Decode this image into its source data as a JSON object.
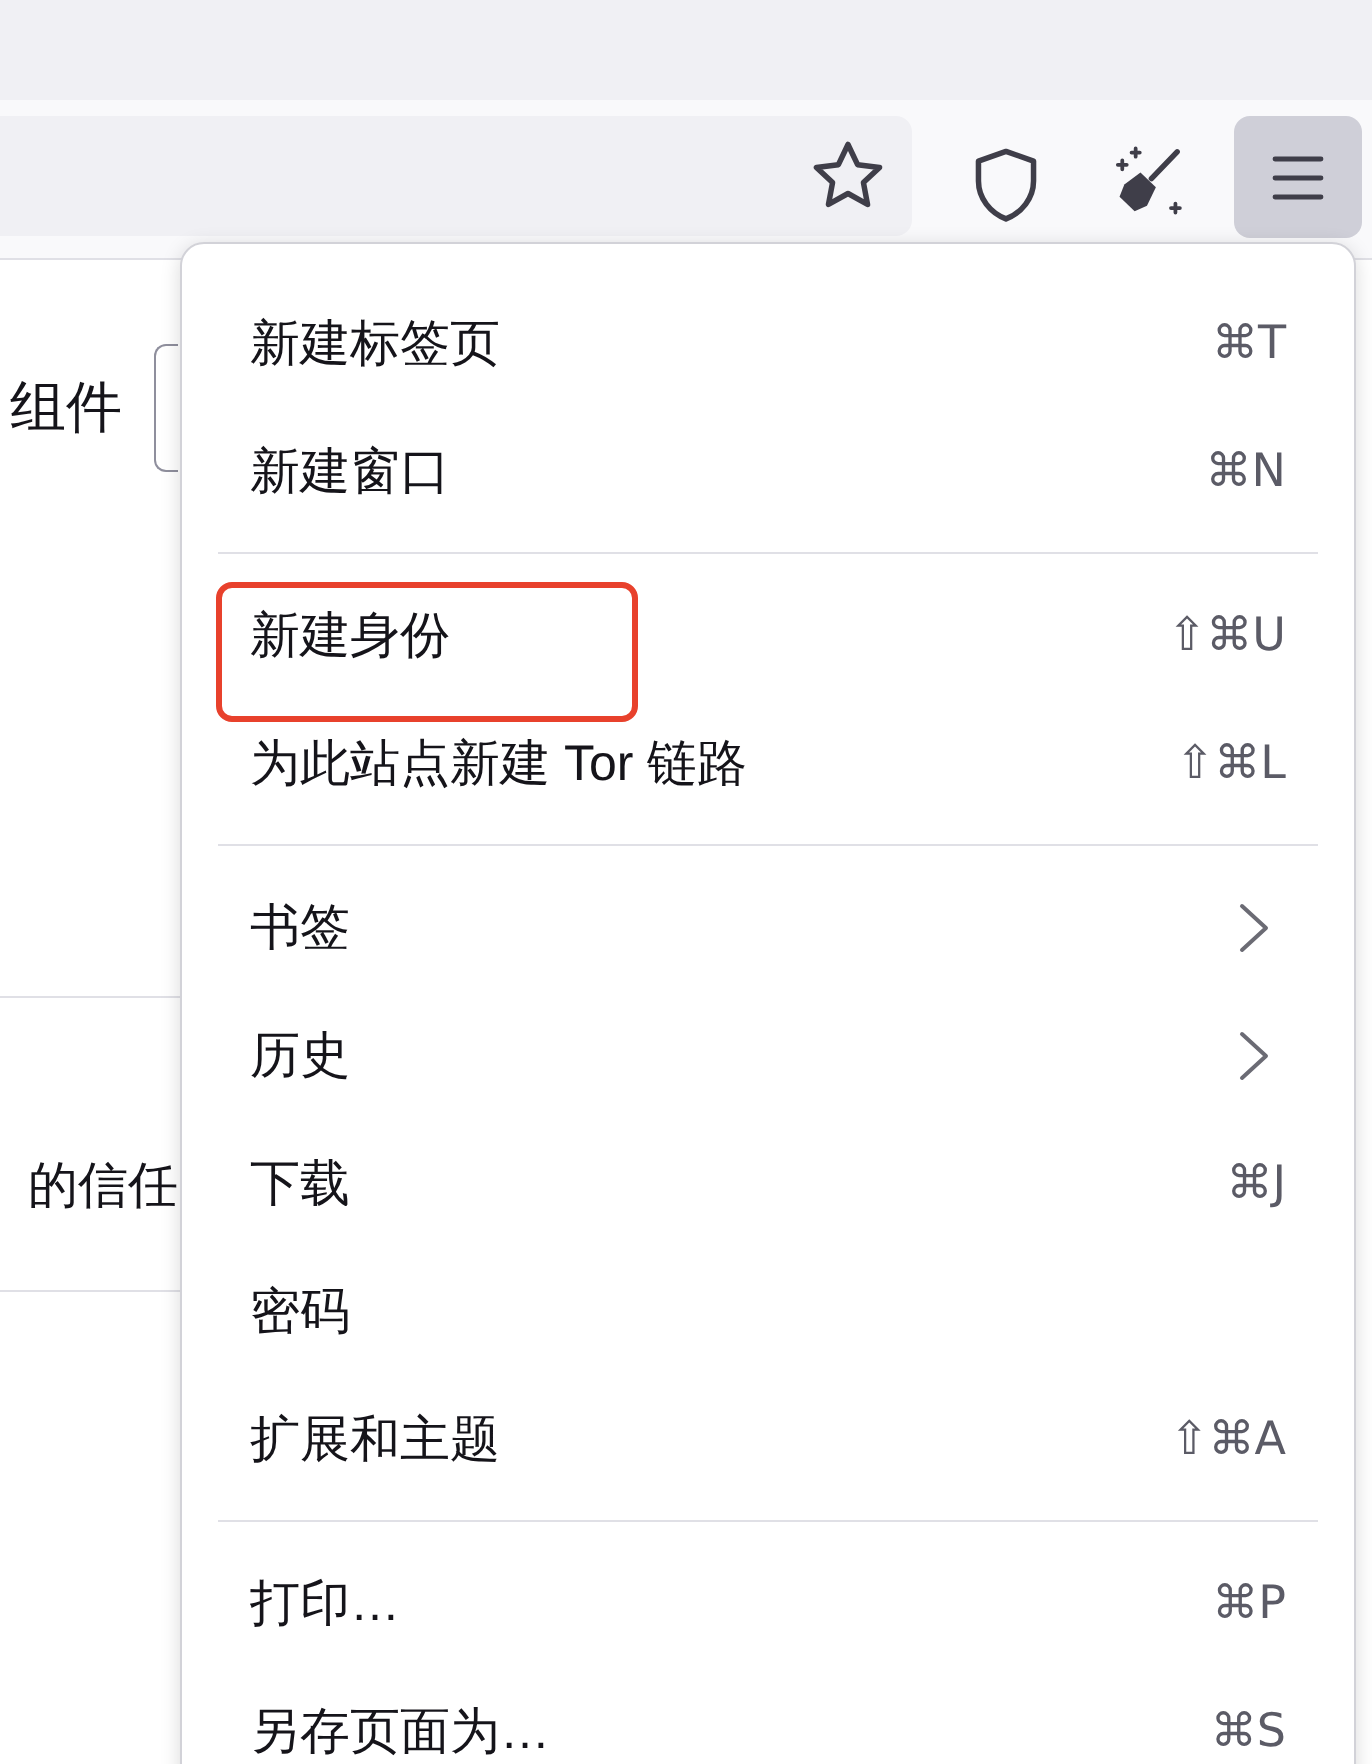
{
  "toolbar": {
    "menu_button": {
      "active": true
    }
  },
  "page": {
    "setting_label": "组件",
    "card_text": "的信任"
  },
  "menu": {
    "sections": [
      {
        "items": [
          {
            "label": "新建标签页",
            "kind": "shortcut",
            "shortcut": "⌘T",
            "highlighted": false
          },
          {
            "label": "新建窗口",
            "kind": "shortcut",
            "shortcut": "⌘N",
            "highlighted": false
          }
        ]
      },
      {
        "items": [
          {
            "label": "新建身份",
            "kind": "shortcut",
            "shortcut": "⇧⌘U",
            "highlighted": true
          },
          {
            "label": "为此站点新建 Tor 链路",
            "kind": "shortcut",
            "shortcut": "⇧⌘L",
            "highlighted": false
          }
        ]
      },
      {
        "items": [
          {
            "label": "书签",
            "kind": "submenu",
            "highlighted": false
          },
          {
            "label": "历史",
            "kind": "submenu",
            "highlighted": false
          },
          {
            "label": "下载",
            "kind": "shortcut",
            "shortcut": "⌘J",
            "highlighted": false
          },
          {
            "label": "密码",
            "kind": "plain",
            "highlighted": false
          },
          {
            "label": "扩展和主题",
            "kind": "shortcut",
            "shortcut": "⇧⌘A",
            "highlighted": false
          }
        ]
      },
      {
        "items": [
          {
            "label": "打印…",
            "kind": "shortcut",
            "shortcut": "⌘P",
            "highlighted": false
          },
          {
            "label": "另存页面为…",
            "kind": "shortcut",
            "shortcut": "⌘S",
            "highlighted": false
          }
        ]
      }
    ]
  }
}
